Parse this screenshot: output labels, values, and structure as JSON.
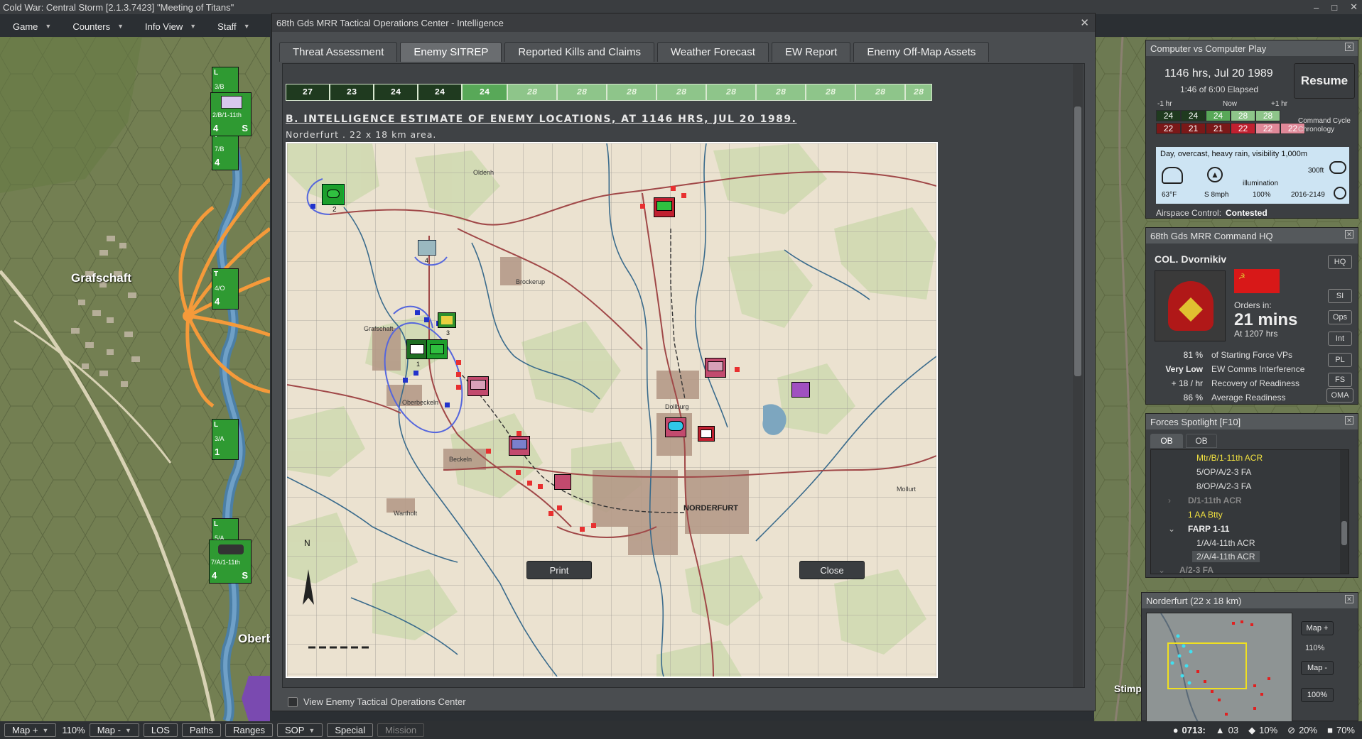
{
  "window": {
    "app_title": "Cold War: Central Storm  [2.1.3.7423]  \"Meeting of Titans\"",
    "min": "–",
    "max": "□",
    "close": "✕"
  },
  "menu": [
    {
      "label": "Game"
    },
    {
      "label": "Counters"
    },
    {
      "label": "Info View"
    },
    {
      "label": "Staff"
    }
  ],
  "left_map": {
    "town_label": "Grafschaft",
    "town2_label": "Oberb",
    "counters": [
      {
        "unit": "2/B/1-11th",
        "size": "4",
        "status": "S"
      },
      {
        "unit": "3/B",
        "size": "4"
      },
      {
        "unit": "7/B",
        "size": "4"
      },
      {
        "unit": "4/O",
        "size": "4"
      },
      {
        "unit": "3/A",
        "size": "1"
      },
      {
        "unit": "5/A",
        "size": "1"
      },
      {
        "unit": "7/A/1-11th",
        "size": "4",
        "status": "S"
      }
    ]
  },
  "right_map": {
    "town_label": "Stimp"
  },
  "dialog": {
    "title": "68th Gds MRR Tactical Operations Center - Intelligence",
    "tabs": [
      {
        "label": "Threat Assessment",
        "active": false
      },
      {
        "label": "Enemy SITREP",
        "active": true
      },
      {
        "label": "Reported Kills and Claims",
        "active": false
      },
      {
        "label": "Weather Forecast",
        "active": false
      },
      {
        "label": "EW Report",
        "active": false
      },
      {
        "label": "Enemy Off-Map Assets",
        "active": false
      }
    ],
    "turns": [
      {
        "label": "27",
        "state": "past"
      },
      {
        "label": "23",
        "state": "past"
      },
      {
        "label": "24",
        "state": "past"
      },
      {
        "label": "24",
        "state": "past"
      },
      {
        "label": "24",
        "state": "current"
      },
      {
        "label": "28",
        "state": "future"
      },
      {
        "label": "28",
        "state": "future"
      },
      {
        "label": "28",
        "state": "future"
      },
      {
        "label": "28",
        "state": "future"
      },
      {
        "label": "28",
        "state": "future"
      },
      {
        "label": "28",
        "state": "future"
      },
      {
        "label": "28",
        "state": "future"
      },
      {
        "label": "28",
        "state": "future"
      },
      {
        "label": "28",
        "state": "future"
      }
    ],
    "estimate_title": "B. INTELLIGENCE ESTIMATE OF ENEMY LOCATIONS, AT 1146 HRS, JUL 20 1989.",
    "estimate_sub": "Norderfurt . 22 x 18 km area.",
    "map_labels": {
      "oldenh": "Oldenh",
      "brockerup": "Brockerup",
      "grafschaft": "Grafschaft",
      "oberbeckeln": "Oberbeckeln",
      "beckeln": "Beckeln",
      "wartholt": "Wartholt",
      "dollburg": "Dollburg",
      "norderfurt": "NORDERFURT",
      "mollurt": "Mollurt",
      "north": "N"
    },
    "unit_numbers": [
      "2",
      "4",
      "3",
      "1"
    ],
    "view_enemy_toc": "View Enemy Tactical Operations Center",
    "print": "Print",
    "close": "Close"
  },
  "cvc": {
    "title": "Computer vs Computer Play",
    "time": "1146 hrs, Jul 20 1989",
    "elapsed": "1:46 of 6:00 Elapsed",
    "resume": "Resume",
    "minus1": "-1 hr",
    "now": "Now",
    "plus1": "+1 hr",
    "row1": [
      "24",
      "24",
      "24",
      "28",
      "28"
    ],
    "row2": [
      "22",
      "21",
      "21",
      "22",
      "22",
      "22"
    ],
    "chron_label_1": "Command Cycle",
    "chron_label_2": "Chronology",
    "weather_desc": "Day, overcast, heavy rain, visibility 1,000m",
    "ceiling": "300ft",
    "temp": "63°F",
    "wind": "S 8mph",
    "illumination_label": "illumination",
    "illumination": "100%",
    "daylight": "2016-2149",
    "airspace_label": "Airspace Control:",
    "airspace_value": "Contested"
  },
  "hq": {
    "title": "68th Gds MRR Command HQ",
    "commander": "COL. Dvornikiv",
    "orders_in": "Orders in:",
    "mins": "21 mins",
    "at": "At 1207 hrs",
    "stats": [
      {
        "value": "81 %",
        "label": "of Starting Force VPs"
      },
      {
        "value": "Very Low",
        "label": "EW Comms Interference"
      },
      {
        "value": "+ 18 / hr",
        "label": "Recovery of Readiness"
      },
      {
        "value": "86 %",
        "label": "Average Readiness"
      }
    ],
    "buttons": [
      "HQ",
      "SI",
      "Ops",
      "Int",
      "PL",
      "FS",
      "OMA"
    ]
  },
  "forces": {
    "title": "Forces Spotlight   [F10]",
    "tabs": [
      "OB",
      "OB"
    ],
    "items": [
      {
        "label": "Mtr/B/1-11th ACR",
        "style": "yellow",
        "indent": 3
      },
      {
        "label": "5/OP/A/2-3 FA",
        "style": "normal",
        "indent": 3
      },
      {
        "label": "8/OP/A/2-3 FA",
        "style": "normal",
        "indent": 3
      },
      {
        "label": "D/1-11th ACR",
        "style": "dim",
        "indent": 2
      },
      {
        "label": "1 AA Btty",
        "style": "yellow",
        "indent": 2
      },
      {
        "label": "FARP 1-11",
        "style": "bold",
        "indent": 2
      },
      {
        "label": "1/A/4-11th ACR",
        "style": "normal",
        "indent": 3
      },
      {
        "label": "2/A/4-11th ACR",
        "style": "selected",
        "indent": 3
      },
      {
        "label": "A/2-3 FA",
        "style": "dim",
        "indent": 1
      }
    ]
  },
  "minimap": {
    "title": "Norderfurt (22 x 18 km)",
    "map_plus": "Map +",
    "zoom": "110%",
    "map_minus": "Map -",
    "hundred": "100%"
  },
  "bottombar": {
    "map_plus": "Map +",
    "zoom": "110%",
    "map_minus": "Map -",
    "los": "LOS",
    "paths": "Paths",
    "ranges": "Ranges",
    "sop": "SOP",
    "special": "Special",
    "mission": "Mission",
    "clock": "0713:",
    "terrain": "03",
    "shield": "10%",
    "hidden": "20%",
    "truck": "70%"
  },
  "colors": {
    "friendly": "#2c8f2c",
    "enemy": "#c24a6e",
    "estimate_blue": "#3344dd",
    "river": "#3a6b8c",
    "road": "#a04848"
  }
}
